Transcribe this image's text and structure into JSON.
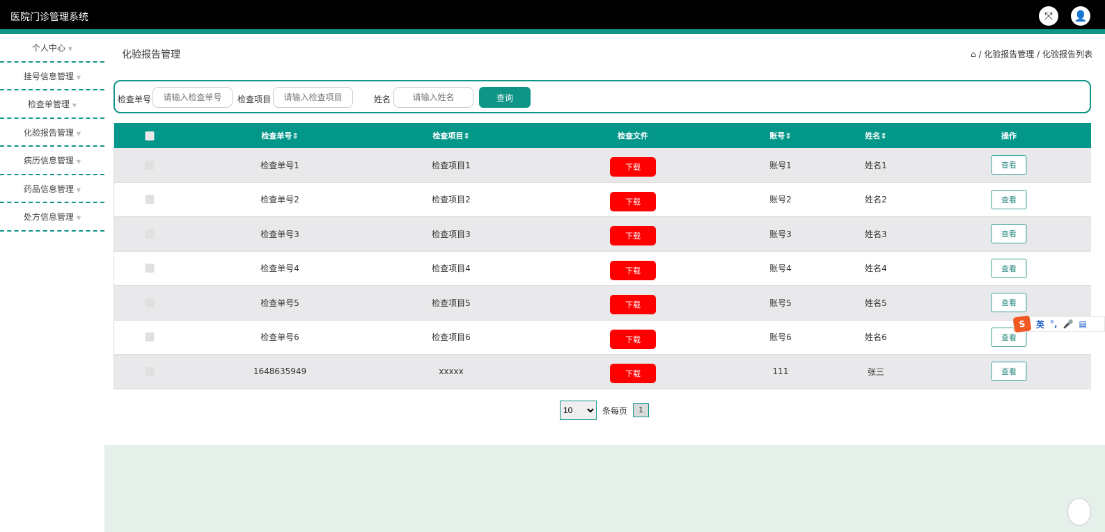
{
  "app": {
    "title": "医院门诊管理系统"
  },
  "sidebar": {
    "items": [
      "个人中心",
      "挂号信息管理",
      "检查单管理",
      "化验报告管理",
      "病历信息管理",
      "药品信息管理",
      "处方信息管理"
    ]
  },
  "page": {
    "title": "化验报告管理",
    "breadcrumb": [
      "化验报告管理",
      "化验报告列表"
    ]
  },
  "search": {
    "fields": [
      {
        "label": "检查单号",
        "placeholder": "请输入检查单号"
      },
      {
        "label": "检查项目",
        "placeholder": "请输入检查项目"
      },
      {
        "label": "姓名",
        "placeholder": "请输入姓名"
      }
    ],
    "button": "查询"
  },
  "table": {
    "headers": [
      "检查单号",
      "检查项目",
      "检查文件",
      "账号",
      "姓名",
      "操作"
    ],
    "download_label": "下载",
    "view_label": "查看",
    "rows": [
      {
        "id": "检查单号1",
        "item": "检查项目1",
        "account": "账号1",
        "name": "姓名1"
      },
      {
        "id": "检查单号2",
        "item": "检查项目2",
        "account": "账号2",
        "name": "姓名2"
      },
      {
        "id": "检查单号3",
        "item": "检查项目3",
        "account": "账号3",
        "name": "姓名3"
      },
      {
        "id": "检查单号4",
        "item": "检查项目4",
        "account": "账号4",
        "name": "姓名4"
      },
      {
        "id": "检查单号5",
        "item": "检查项目5",
        "account": "账号5",
        "name": "姓名5"
      },
      {
        "id": "检查单号6",
        "item": "检查项目6",
        "account": "账号6",
        "name": "姓名6"
      },
      {
        "id": "1648635949",
        "item": "xxxxx",
        "account": "111",
        "name": "张三"
      }
    ]
  },
  "pagination": {
    "page_size": "10",
    "per_page_label": "条每页",
    "current_page": "1"
  },
  "ime": {
    "logo": "S",
    "mode": "英",
    "punct": "°,"
  },
  "colors": {
    "accent": "#0f9488",
    "danger": "#ff0000"
  }
}
